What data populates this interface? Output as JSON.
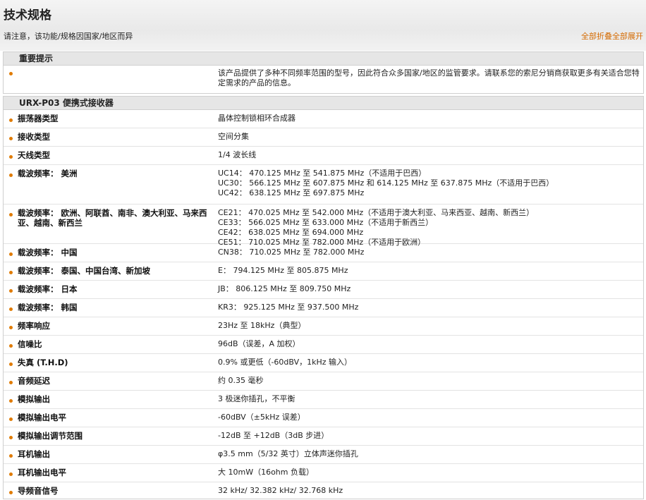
{
  "header": {
    "title": "技术规格",
    "notice": "请注意，该功能/规格因国家/地区而异",
    "toggle_all": "全部折叠全部展开"
  },
  "important": {
    "heading": "重要提示",
    "text": "该产品提供了多种不同频率范围的型号，因此符合众多国家/地区的监管要求。请联系您的索尼分销商获取更多有关适合您特定需求的产品的信息。"
  },
  "specs": {
    "heading": "URX-P03 便携式接收器",
    "rows": [
      {
        "label": "振荡器类型",
        "lines": [
          "晶体控制锁相环合成器"
        ]
      },
      {
        "label": "接收类型",
        "lines": [
          "空间分集"
        ]
      },
      {
        "label": "天线类型",
        "lines": [
          "1/4 波长线"
        ]
      },
      {
        "label": "载波频率： 美洲",
        "lines": [
          "UC14： 470.125 MHz 至 541.875 MHz（不适用于巴西）",
          "UC30： 566.125 MHz 至 607.875 MHz 和 614.125 MHz 至 637.875 MHz（不适用于巴西）",
          "UC42： 638.125 MHz 至 697.875 MHz"
        ]
      },
      {
        "label": "载波频率： 欧洲、阿联酋、南非、澳大利亚、马来西亚、越南、新西兰",
        "lines": [
          "CE21： 470.025 MHz 至 542.000 MHz（不适用于澳大利亚、马来西亚、越南、新西兰）",
          "CE33： 566.025 MHz 至 633.000 MHz（不适用于新西兰）",
          "CE42： 638.025 MHz 至 694.000 MHz",
          "CE51： 710.025 MHz 至 782.000 MHz（不适用于欧洲）"
        ]
      },
      {
        "label": "载波频率： 中国",
        "lines": [
          "CN38： 710.025 MHz 至 782.000 MHz"
        ]
      },
      {
        "label": "载波频率： 泰国、中国台湾、新加坡",
        "lines": [
          "E： 794.125 MHz 至 805.875 MHz"
        ]
      },
      {
        "label": "载波频率： 日本",
        "lines": [
          "JB： 806.125 MHz 至 809.750 MHz"
        ]
      },
      {
        "label": "载波频率： 韩国",
        "lines": [
          "KR3： 925.125 MHz 至 937.500 MHz"
        ]
      },
      {
        "label": "频率响应",
        "lines": [
          "23Hz 至 18kHz（典型）"
        ]
      },
      {
        "label": "信噪比",
        "lines": [
          "96dB（误差，A 加权）"
        ]
      },
      {
        "label": "失真 (T.H.D)",
        "lines": [
          "0.9% 或更低（-60dBV，1kHz 输入）"
        ]
      },
      {
        "label": "音频延迟",
        "lines": [
          "约 0.35 毫秒"
        ]
      },
      {
        "label": "模拟输出",
        "lines": [
          "3 极迷你插孔，不平衡"
        ]
      },
      {
        "label": "模拟输出电平",
        "lines": [
          "-60dBV（±5kHz 误差）"
        ]
      },
      {
        "label": "模拟输出调节范围",
        "lines": [
          "-12dB 至 +12dB（3dB 步进）"
        ]
      },
      {
        "label": "耳机输出",
        "lines": [
          "φ3.5 mm（5/32 英寸）立体声迷你插孔"
        ]
      },
      {
        "label": "耳机输出电平",
        "lines": [
          "大 10mW（16ohm 负载）"
        ]
      },
      {
        "label": "导频音信号",
        "lines": [
          "32 kHz/ 32.382 kHz/ 32.768 kHz"
        ]
      }
    ]
  }
}
